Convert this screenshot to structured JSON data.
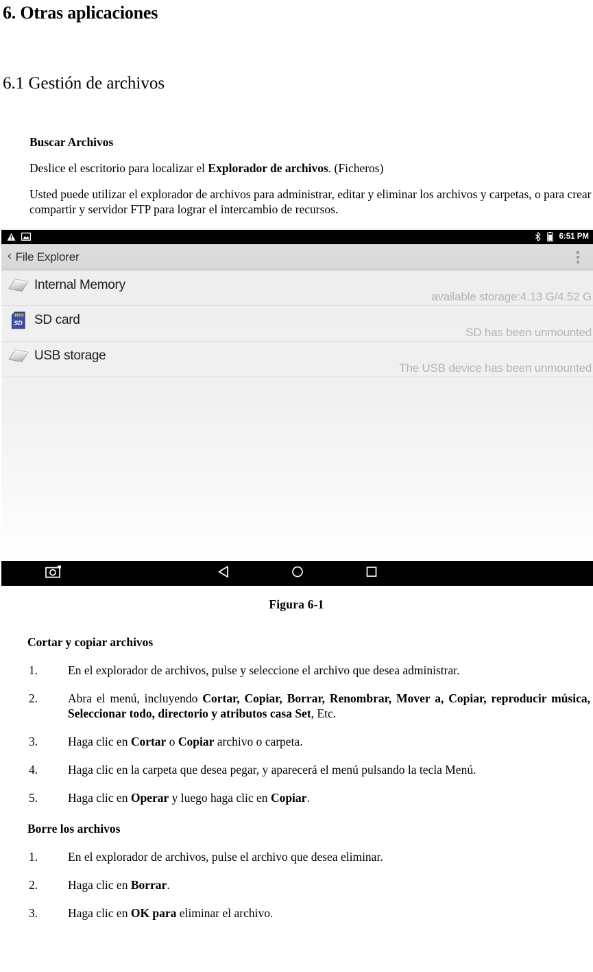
{
  "document": {
    "chapter_heading": "6. Otras aplicaciones",
    "section_heading": "6.1 Gestión de archivos",
    "subsection_heading": "Buscar Archivos",
    "intro_paragraph_1_pre": "Deslice el escritorio para localizar el ",
    "intro_paragraph_1_bold": "Explorador de archivos",
    "intro_paragraph_1_post": ". (Ficheros)",
    "intro_paragraph_2": "Usted puede utilizar el explorador de archivos para administrar, editar y eliminar los archivos y carpetas, o para crear compartir y servidor FTP para lograr el intercambio de recursos.",
    "figure_caption": "Figura 6-1"
  },
  "screenshot": {
    "status_bar": {
      "left_icons": [
        "warning-triangle-icon",
        "screenshot-image-icon"
      ],
      "right_icons": [
        "bluetooth-icon",
        "battery-icon"
      ],
      "time": "6:51 PM"
    },
    "title_bar": {
      "back_chevron": "‹",
      "title": "File Explorer",
      "overflow_icon": "overflow-menu-icon"
    },
    "storage_items": [
      {
        "icon": "disk-icon",
        "label": "Internal Memory",
        "status": "available storage:4.13 G/4.52 G"
      },
      {
        "icon": "sd-card-icon",
        "label": "SD card",
        "status": "SD has been unmounted"
      },
      {
        "icon": "disk-icon",
        "label": "USB storage",
        "status": "The USB device has been unmounted"
      }
    ],
    "nav_bar": {
      "screenshot_button": "screenshot-camera-icon",
      "back_button": "back-triangle-icon",
      "home_button": "home-circle-icon",
      "recents_button": "recents-square-icon"
    },
    "colors": {
      "status_bar_bg": "#000000",
      "title_bar_bg": "#d8d8d6",
      "list_bg": "#eeeeee",
      "secondary_text": "#b4b4b4",
      "sd_card_blue": "#3b4fa8"
    }
  },
  "sections": [
    {
      "heading": "Cortar y copiar archivos",
      "steps": [
        {
          "num": "1.",
          "parts": [
            {
              "t": "En el explorador de archivos, pulse y seleccione el archivo que desea administrar.",
              "b": false
            }
          ]
        },
        {
          "num": "2.",
          "justify": true,
          "parts": [
            {
              "t": "Abra el menú, incluyendo ",
              "b": false
            },
            {
              "t": "Cortar, Copiar, Borrar, Renombrar, Mover a, Copiar, reproducir música, Seleccionar todo, directorio y atributos casa Set",
              "b": true
            },
            {
              "t": ", Etc.",
              "b": false
            }
          ]
        },
        {
          "num": "3.",
          "parts": [
            {
              "t": "Haga clic en ",
              "b": false
            },
            {
              "t": "Cortar",
              "b": true
            },
            {
              "t": " o ",
              "b": false
            },
            {
              "t": "Copiar",
              "b": true
            },
            {
              "t": " archivo o carpeta.",
              "b": false
            }
          ]
        },
        {
          "num": "4.",
          "parts": [
            {
              "t": "Haga clic en la carpeta que desea pegar, y aparecerá el menú pulsando la tecla Menú.",
              "b": false
            }
          ]
        },
        {
          "num": "5.",
          "parts": [
            {
              "t": "Haga clic en ",
              "b": false
            },
            {
              "t": "Operar",
              "b": true
            },
            {
              "t": " y luego haga clic en ",
              "b": false
            },
            {
              "t": "Copiar",
              "b": true
            },
            {
              "t": ".",
              "b": false
            }
          ]
        }
      ]
    },
    {
      "heading": "Borre los archivos",
      "steps": [
        {
          "num": "1.",
          "parts": [
            {
              "t": "En el explorador de archivos, pulse el archivo que desea eliminar.",
              "b": false
            }
          ]
        },
        {
          "num": "2.",
          "parts": [
            {
              "t": "Haga clic en ",
              "b": false
            },
            {
              "t": "Borrar",
              "b": true
            },
            {
              "t": ".",
              "b": false
            }
          ]
        },
        {
          "num": "3.",
          "parts": [
            {
              "t": "Haga clic en ",
              "b": false
            },
            {
              "t": "OK para",
              "b": true
            },
            {
              "t": " eliminar el archivo.",
              "b": false
            }
          ]
        }
      ]
    }
  ]
}
